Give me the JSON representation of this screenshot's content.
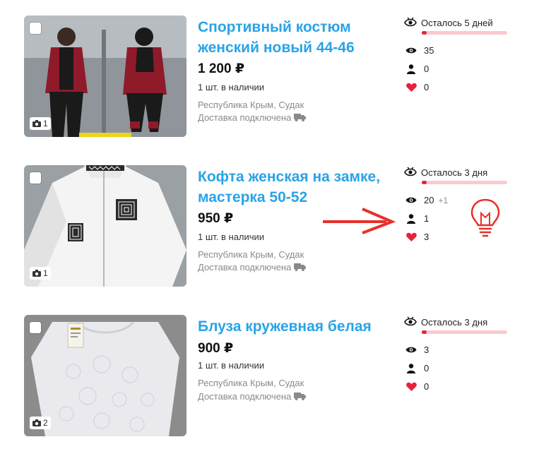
{
  "listings": [
    {
      "title": "Спортивный костюм женский новый 44-46",
      "price": "1 200 ₽",
      "stock": "1 шт. в наличии",
      "location": "Республика Крым, Судак",
      "delivery": "Доставка подключена",
      "photo_count": "1",
      "remaining": "Осталось 5 дней",
      "remaining_fraction": 0.06,
      "views": "35",
      "views_delta": "",
      "contacts": "0",
      "favorites": "0"
    },
    {
      "title": "Кофта женская на замке, мастерка 50-52",
      "price": "950 ₽",
      "stock": "1 шт. в наличии",
      "location": "Республика Крым, Судак",
      "delivery": "Доставка подключена",
      "photo_count": "1",
      "remaining": "Осталось 3 дня",
      "remaining_fraction": 0.06,
      "views": "20",
      "views_delta": "+1",
      "contacts": "1",
      "favorites": "3"
    },
    {
      "title": "Блуза кружевная белая",
      "price": "900 ₽",
      "stock": "1 шт. в наличии",
      "location": "Республика Крым, Судак",
      "delivery": "Доставка подключена",
      "photo_count": "2",
      "remaining": "Осталось 3 дня",
      "remaining_fraction": 0.06,
      "views": "3",
      "views_delta": "",
      "contacts": "0",
      "favorites": "0"
    }
  ],
  "colors": {
    "title": "#2aa3e6",
    "bar_fill": "#e8213b",
    "bar_track": "#fbc9cf",
    "heart": "#e8213b",
    "annotation": "#e8302a"
  },
  "icons": [
    "checkbox",
    "camera-icon",
    "truck-icon",
    "timer-eye-icon",
    "eye-icon",
    "person-icon",
    "heart-icon",
    "arrow-annotation",
    "lightbulb-annotation"
  ]
}
